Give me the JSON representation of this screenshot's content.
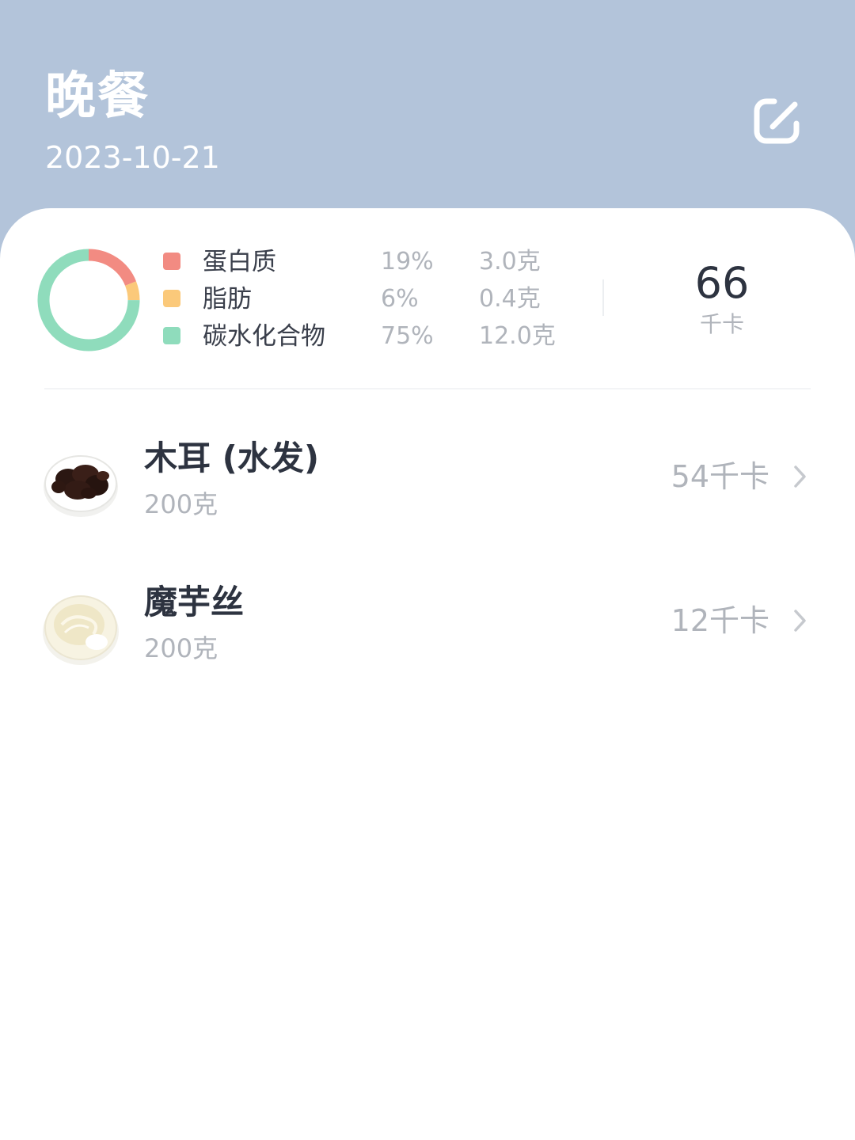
{
  "header": {
    "title": "晚餐",
    "date": "2023-10-21",
    "edit_icon": "edit-icon",
    "background_color": "#b3c4da"
  },
  "summary": {
    "nutrients": [
      {
        "name": "蛋白质",
        "percent": "19%",
        "grams": "3.0克",
        "color": "#f28b82",
        "share": 19
      },
      {
        "name": "脂肪",
        "percent": "6%",
        "grams": "0.4克",
        "color": "#fbc97a",
        "share": 6
      },
      {
        "name": "碳水化合物",
        "percent": "75%",
        "grams": "12.0克",
        "color": "#8fdcbc",
        "share": 75
      }
    ],
    "total_kcal": "66",
    "kcal_unit": "千卡"
  },
  "foods": [
    {
      "name": "木耳 (水发)",
      "weight": "200克",
      "kcal": "54千卡",
      "thumb_icon": "wood-ear-mushroom-photo",
      "chevron_icon": "chevron-right-icon"
    },
    {
      "name": "魔芋丝",
      "weight": "200克",
      "kcal": "12千卡",
      "thumb_icon": "konjac-noodles-photo",
      "chevron_icon": "chevron-right-icon"
    }
  ]
}
